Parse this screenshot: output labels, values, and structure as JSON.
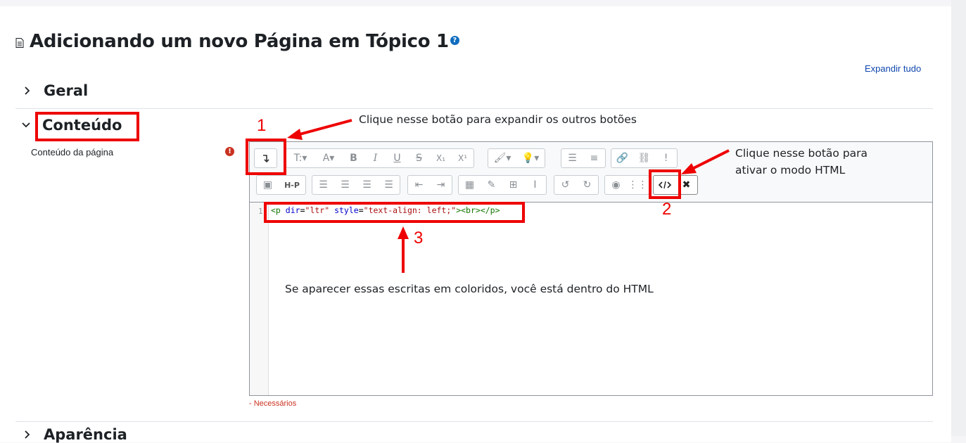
{
  "page": {
    "title": "Adicionando um novo Página em Tópico 1",
    "help_icon": "?",
    "expand_all": "Expandir tudo"
  },
  "sections": {
    "geral": "Geral",
    "conteudo": "Conteúdo",
    "aparencia": "Aparência"
  },
  "field": {
    "label": "Conteúdo da página",
    "required_icon": "!"
  },
  "toolbar": {
    "row1": [
      "expand-toggle",
      "font-style-dropdown",
      "font-color-dropdown",
      "bold",
      "italic",
      "underline",
      "strikethrough",
      "subscript",
      "superscript",
      "paint-brush-dropdown",
      "lightbulb-dropdown",
      "bullet-list",
      "numbered-list",
      "link",
      "unlink",
      "required-warning"
    ],
    "row2": [
      "image",
      "h5p",
      "align-left",
      "align-center",
      "align-right",
      "align-justify",
      "outdent",
      "indent",
      "equation",
      "edit",
      "table",
      "clear-format",
      "undo",
      "redo",
      "accessibility",
      "screenreader",
      "html-mode",
      "fullscreen"
    ],
    "labels": {
      "bold": "B",
      "italic": "I",
      "underline": "U",
      "strike": "S",
      "subscript": "X₁",
      "superscript": "X¹",
      "h5p": "H-P",
      "warning": "!"
    }
  },
  "code": {
    "line_number": "1",
    "tag_open": "<p",
    "attr1": "dir",
    "eq1": "=",
    "val1": "\"ltr\"",
    "attr2": "style",
    "eq2": "=",
    "val2": "\"text-align: left;\"",
    "tag_close": "><br></p>"
  },
  "footer": {
    "required_note": "- Necessários"
  },
  "annotations": {
    "n1": "1",
    "n2": "2",
    "n3": "3",
    "note1": "Clique nesse botão para expandir os outros botões",
    "note2_line1": "Clique nesse botão para",
    "note2_line2": "ativar o modo HTML",
    "note3": "Se aparecer essas escritas em coloridos, você está dentro do HTML",
    "color": "#ee0000"
  }
}
